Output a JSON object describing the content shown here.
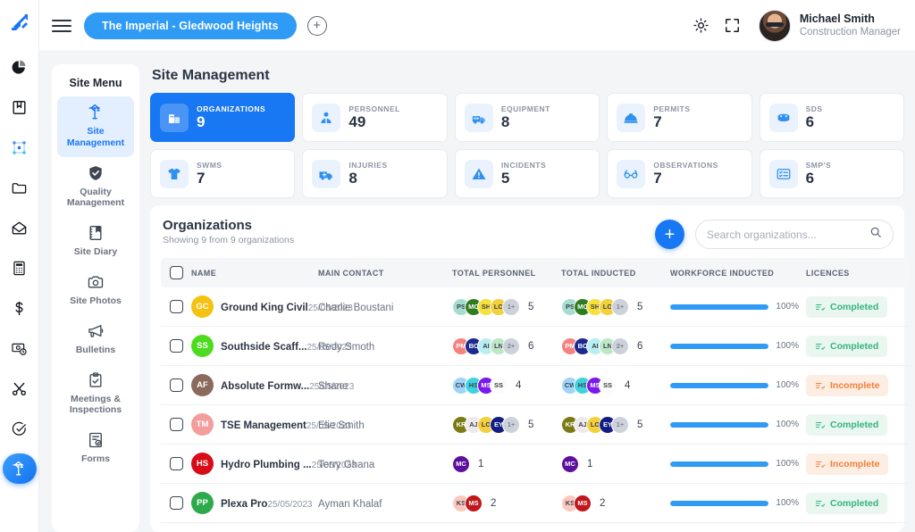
{
  "brand": {
    "logo_icon": "app-logo-icon",
    "accent": "#1877f2"
  },
  "header": {
    "menu_icon": "hamburger-icon",
    "site_pill": "The Imperial - Gledwood Heights",
    "add_site_icon": "plus-circle-icon",
    "theme_icon": "sun-icon",
    "fullscreen_icon": "fullscreen-icon",
    "user": {
      "name": "Michael Smith",
      "role": "Construction Manager",
      "avatar_icon": "user-avatar"
    }
  },
  "rail": {
    "items": [
      {
        "icon": "pie-chart-icon",
        "active": false
      },
      {
        "icon": "book-icon",
        "active": false
      },
      {
        "icon": "sitemap-icon",
        "active": false
      },
      {
        "icon": "folder-icon",
        "active": false
      },
      {
        "icon": "envelope-icon",
        "active": false
      },
      {
        "icon": "calculator-icon",
        "active": false
      },
      {
        "icon": "dollar-icon",
        "active": false
      },
      {
        "icon": "money-time-icon",
        "active": false
      },
      {
        "icon": "scissors-icon",
        "active": false
      },
      {
        "icon": "check-circle-icon",
        "active": false
      },
      {
        "icon": "crane-icon",
        "active": true
      }
    ]
  },
  "sidemenu": {
    "title": "Site Menu",
    "items": [
      {
        "label": "Site Management",
        "icon": "crane-icon",
        "active": true
      },
      {
        "label": "Quality Management",
        "icon": "shield-check-icon",
        "active": false
      },
      {
        "label": "Site Diary",
        "icon": "diary-icon",
        "active": false
      },
      {
        "label": "Site Photos",
        "icon": "camera-icon",
        "active": false
      },
      {
        "label": "Bulletins",
        "icon": "megaphone-icon",
        "active": false
      },
      {
        "label": "Meetings & Inspections",
        "icon": "clipboard-check-icon",
        "active": false
      },
      {
        "label": "Forms",
        "icon": "form-icon",
        "active": false
      }
    ]
  },
  "main": {
    "page_title": "Site Management",
    "cards_row1": [
      {
        "label": "ORGANIZATIONS",
        "value": "9",
        "icon": "building-icon",
        "highlight": true
      },
      {
        "label": "PERSONNEL",
        "value": "49",
        "icon": "person-icon",
        "highlight": false
      },
      {
        "label": "EQUIPMENT",
        "value": "8",
        "icon": "equipment-icon",
        "highlight": false
      },
      {
        "label": "PERMITS",
        "value": "7",
        "icon": "hardhat-icon",
        "highlight": false
      },
      {
        "label": "SDS",
        "value": "6",
        "icon": "barrel-icon",
        "highlight": false
      }
    ],
    "cards_row2": [
      {
        "label": "SWMS",
        "value": "7",
        "icon": "shirt-icon",
        "highlight": false
      },
      {
        "label": "INJURIES",
        "value": "8",
        "icon": "ambulance-icon",
        "highlight": false
      },
      {
        "label": "INCIDENTS",
        "value": "5",
        "icon": "warning-icon",
        "highlight": false
      },
      {
        "label": "OBSERVATIONS",
        "value": "7",
        "icon": "glasses-icon",
        "highlight": false
      },
      {
        "label": "SMP'S",
        "value": "6",
        "icon": "checklist-icon",
        "highlight": false
      }
    ]
  },
  "organizations": {
    "title": "Organizations",
    "subtitle": "Showing 9 from 9 organizations",
    "add_icon": "plus-icon",
    "search": {
      "placeholder": "Search organizations...",
      "value": "",
      "icon": "search-icon"
    },
    "columns": [
      "NAME",
      "MAIN CONTACT",
      "TOTAL PERSONNEL",
      "TOTAL INDUCTED",
      "WORKFORCE INDUCTED",
      "LICENCES"
    ],
    "rows": [
      {
        "name": "Ground King Civil",
        "date": "25/05/2023",
        "initials": "GC",
        "color": "#f5c211",
        "contact": "Charlie Boustani",
        "personnel": {
          "avatars": [
            {
              "t": "PS",
              "c": "#a7ddd0"
            },
            {
              "t": "MC",
              "c": "#2f7d20"
            },
            {
              "t": "SH",
              "c": "#f7e038"
            },
            {
              "t": "LO",
              "c": "#f4d03a"
            }
          ],
          "more": "1+",
          "count": "5"
        },
        "inducted": {
          "avatars": [
            {
              "t": "PS",
              "c": "#a7ddd0"
            },
            {
              "t": "MC",
              "c": "#2f7d20"
            },
            {
              "t": "SH",
              "c": "#f7e038"
            },
            {
              "t": "LO",
              "c": "#f4d03a"
            }
          ],
          "more": "1+",
          "count": "5"
        },
        "workforce_pct": 100,
        "workforce_label": "100%",
        "licence_status": "Completed",
        "licence_state": "completed"
      },
      {
        "name": "Southside Scaff...",
        "date": "25/05/2023",
        "initials": "SS",
        "color": "#4cdb1f",
        "contact": "Redy Smoth",
        "personnel": {
          "avatars": [
            {
              "t": "PM",
              "c": "#f4837d"
            },
            {
              "t": "BC",
              "c": "#1c2a8f"
            },
            {
              "t": "AI",
              "c": "#b9eef0"
            },
            {
              "t": "LN",
              "c": "#bce6c6"
            }
          ],
          "more": "2+",
          "count": "6"
        },
        "inducted": {
          "avatars": [
            {
              "t": "PM",
              "c": "#f4837d"
            },
            {
              "t": "BC",
              "c": "#1c2a8f"
            },
            {
              "t": "AI",
              "c": "#b9eef0"
            },
            {
              "t": "LN",
              "c": "#bce6c6"
            }
          ],
          "more": "2+",
          "count": "6"
        },
        "workforce_pct": 100,
        "workforce_label": "100%",
        "licence_status": "Completed",
        "licence_state": "completed"
      },
      {
        "name": "Absolute Formw...",
        "date": "25/05/2023",
        "initials": "AF",
        "color": "#8a6a5c",
        "contact": "Shane",
        "personnel": {
          "avatars": [
            {
              "t": "CW",
              "c": "#9ed5f7"
            },
            {
              "t": "HS",
              "c": "#3fd3e0"
            },
            {
              "t": "MS",
              "c": "#7b17ef"
            },
            {
              "t": "SS",
              "c": "#fbfbfb"
            }
          ],
          "more": "",
          "count": "4"
        },
        "inducted": {
          "avatars": [
            {
              "t": "CW",
              "c": "#9ed5f7"
            },
            {
              "t": "HS",
              "c": "#3fd3e0"
            },
            {
              "t": "MS",
              "c": "#7b17ef"
            },
            {
              "t": "SS",
              "c": "#fbfbfb"
            }
          ],
          "more": "",
          "count": "4"
        },
        "workforce_pct": 100,
        "workforce_label": "100%",
        "licence_status": "Incomplete",
        "licence_state": "incomplete"
      },
      {
        "name": "TSE Management",
        "date": "25/05/2023",
        "initials": "TM",
        "color": "#f39d9d",
        "contact": "Elie Smith",
        "personnel": {
          "avatars": [
            {
              "t": "KR",
              "c": "#7d7a15"
            },
            {
              "t": "AJ",
              "c": "#eceaea"
            },
            {
              "t": "LO",
              "c": "#f4d03a"
            },
            {
              "t": "EY",
              "c": "#111d82"
            }
          ],
          "more": "1+",
          "count": "5"
        },
        "inducted": {
          "avatars": [
            {
              "t": "KR",
              "c": "#7d7a15"
            },
            {
              "t": "AJ",
              "c": "#eceaea"
            },
            {
              "t": "LO",
              "c": "#f4d03a"
            },
            {
              "t": "EY",
              "c": "#111d82"
            }
          ],
          "more": "1+",
          "count": "5"
        },
        "workforce_pct": 100,
        "workforce_label": "100%",
        "licence_status": "Completed",
        "licence_state": "completed"
      },
      {
        "name": "Hydro Plumbing ...",
        "date": "25/05/2023",
        "initials": "HS",
        "color": "#d80b17",
        "contact": "Terry Ghana",
        "personnel": {
          "avatars": [
            {
              "t": "MC",
              "c": "#5d0f9e"
            }
          ],
          "more": "",
          "count": "1"
        },
        "inducted": {
          "avatars": [
            {
              "t": "MC",
              "c": "#5d0f9e"
            }
          ],
          "more": "",
          "count": "1"
        },
        "workforce_pct": 100,
        "workforce_label": "100%",
        "licence_status": "Incomplete",
        "licence_state": "incomplete"
      },
      {
        "name": "Plexa Pro",
        "date": "25/05/2023",
        "initials": "PP",
        "color": "#2eaa4b",
        "contact": "Ayman Khalaf",
        "personnel": {
          "avatars": [
            {
              "t": "KS",
              "c": "#fac8bd"
            },
            {
              "t": "MS",
              "c": "#c1161a"
            }
          ],
          "more": "",
          "count": "2"
        },
        "inducted": {
          "avatars": [
            {
              "t": "KS",
              "c": "#fac8bd"
            },
            {
              "t": "MS",
              "c": "#c1161a"
            }
          ],
          "more": "",
          "count": "2"
        },
        "workforce_pct": 100,
        "workforce_label": "100%",
        "licence_status": "Completed",
        "licence_state": "completed"
      }
    ]
  }
}
